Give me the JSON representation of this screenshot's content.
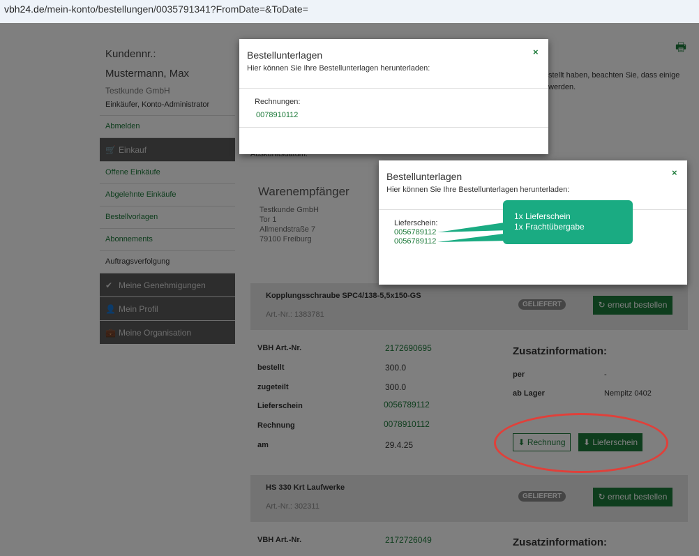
{
  "url": {
    "host": "vbh24.de",
    "path": "/mein-konto/bestellungen/0035791341?FromDate=&ToDate="
  },
  "sidebar": {
    "kundennr": "Kundennr.:",
    "name": "Mustermann, Max",
    "company": "Testkunde GmbH",
    "role": "Einkäufer, Konto-Administrator",
    "items": [
      {
        "label": "Abmelden"
      },
      {
        "label": "Einkauf"
      },
      {
        "label": "Offene Einkäufe"
      },
      {
        "label": "Abgelehnte Einkäufe"
      },
      {
        "label": "Bestellvorlagen"
      },
      {
        "label": "Abonnements"
      },
      {
        "label": "Auftragsverfolgung"
      },
      {
        "label": "Meine Genehmigungen"
      },
      {
        "label": "Mein Profil"
      },
      {
        "label": "Meine Organisation"
      }
    ]
  },
  "main": {
    "partial_line1": "stellt haben, beachten Sie, dass einige",
    "partial_line2": "werden.",
    "auskunft": "Auskunftsdatum:",
    "warenempfaenger": {
      "title": "Warenempfänger",
      "lines": [
        "Testkunde GmbH",
        "Tor 1",
        "Allmendstraße 7",
        "79100 Freiburg"
      ]
    }
  },
  "items": [
    {
      "title": "Kopplungsschraube SPC4/138-5,5x150-GS",
      "art": "Art.-Nr.: 1383781",
      "status": "GELIEFERT",
      "reorder": "erneut bestellen",
      "vbh_label": "VBH Art.-Nr.",
      "vbh_value": "2172690695",
      "bestellt_label": "bestellt",
      "bestellt_value": "300.0",
      "zugeteilt_label": "zugeteilt",
      "zugeteilt_value": "300.0",
      "lieferschein_label": "Lieferschein",
      "lieferschein_value": "0056789112",
      "rechnung_label": "Rechnung",
      "rechnung_value": "0078910112",
      "am_label": "am",
      "am_value": "29.4.25",
      "zusatz": "Zusatzinformation:",
      "per_label": "per",
      "per_value": "-",
      "lager_label": "ab Lager",
      "lager_value": "Nempitz 0402",
      "btn_rechnung": "Rechnung",
      "btn_lieferschein": "Lieferschein"
    },
    {
      "title": "HS 330 Krt Laufwerke",
      "art": "Art.-Nr.: 302311",
      "status": "GELIEFERT",
      "reorder": "erneut bestellen",
      "vbh_label": "VBH Art.-Nr.",
      "vbh_value": "2172726049",
      "zusatz": "Zusatzinformation:"
    }
  ],
  "modal1": {
    "title": "Bestellunterlagen",
    "subtitle": "Hier können Sie Ihre Bestellunterlagen herunterladen:",
    "label": "Rechnungen:",
    "links": [
      "0078910112"
    ],
    "close": "×"
  },
  "modal2": {
    "title": "Bestellunterlagen",
    "subtitle": "Hier können Sie Ihre Bestellunterlagen herunterladen:",
    "label": "Lieferschein:",
    "links": [
      "0056789112",
      "0056789112"
    ],
    "close": "×"
  },
  "callout": {
    "line1": "1x Lieferschein",
    "line2": "1x Frachtübergabe"
  },
  "colors": {
    "green": "#1d7a3a",
    "callout": "#1aab82",
    "ellipse": "#e0403a"
  },
  "icons": [
    "printer-icon",
    "cart-icon",
    "check-icon",
    "user-icon",
    "briefcase-icon",
    "refresh-icon",
    "download-icon",
    "close-icon"
  ]
}
